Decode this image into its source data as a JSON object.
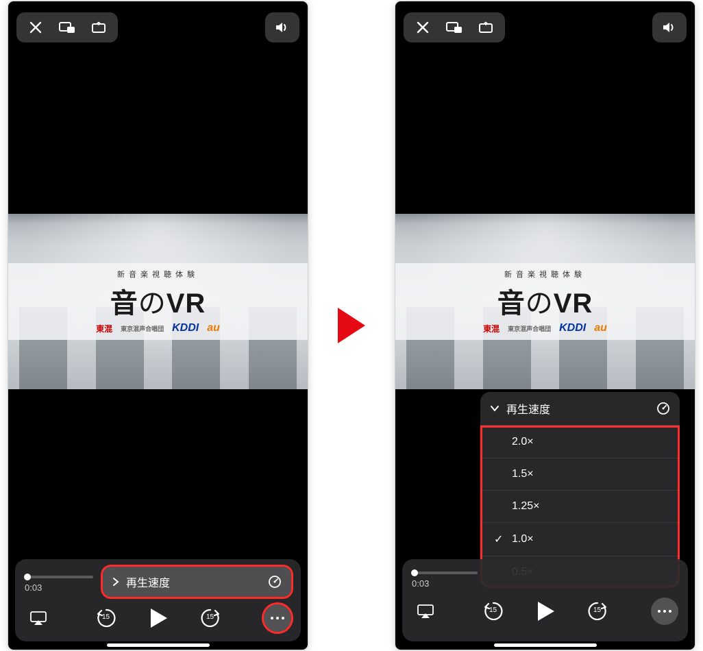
{
  "video": {
    "overline": "新音楽視聴体験",
    "title_pre": "音",
    "title_no": "の",
    "title_post": "VR",
    "logo_tokon": "東混",
    "logo_tokon_sub": "東京混声合唱団",
    "logo_kddi": "KDDI",
    "logo_au": "au"
  },
  "player": {
    "time": "0:03",
    "skip_seconds": "15"
  },
  "speed_chip": {
    "label": "再生速度"
  },
  "speed_menu": {
    "label": "再生速度",
    "options": [
      {
        "label": "2.0×",
        "selected": false
      },
      {
        "label": "1.5×",
        "selected": false
      },
      {
        "label": "1.25×",
        "selected": false
      },
      {
        "label": "1.0×",
        "selected": true
      },
      {
        "label": "0.5×",
        "selected": false
      }
    ]
  }
}
